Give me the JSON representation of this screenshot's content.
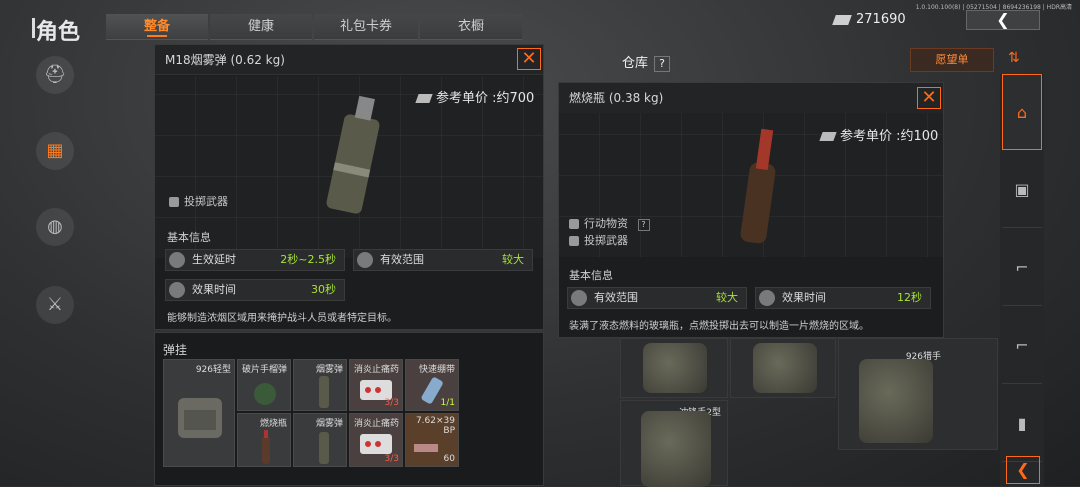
{
  "header": {
    "title": "角色",
    "tabs": [
      "整备",
      "健康",
      "礼包卡券",
      "衣橱"
    ],
    "money": "271690",
    "version": "1.0.100.100(8) | 05271504 | 86942361​98 | HDR高清"
  },
  "item1": {
    "name": "M18烟雾弹 (0.62 kg)",
    "price": "参考单价 :约700",
    "category": "投掷武器",
    "section": "基本信息",
    "stats": [
      {
        "label": "生效延时",
        "value": "2秒~2.5秒"
      },
      {
        "label": "有效范围",
        "value": "较大"
      },
      {
        "label": "效果时间",
        "value": "30秒"
      }
    ],
    "description": "能够制造浓烟区域用来掩护战斗人员或者特定目标。"
  },
  "item2": {
    "name": "燃烧瓶 (0.38 kg)",
    "price": "参考单价 :约100",
    "category1": "行动物资",
    "category2": "投掷武器",
    "section": "基本信息",
    "stats": [
      {
        "label": "有效范围",
        "value": "较大"
      },
      {
        "label": "效果时间",
        "value": "12秒"
      }
    ],
    "description": "装满了液态燃料的玻璃瓶，点燃投掷出去可以制造一片燃烧的区域。"
  },
  "loadout": {
    "title": "弹挂",
    "vest": "926轻型",
    "slots": [
      {
        "name": "破片手榴弹",
        "count": ""
      },
      {
        "name": "烟雾弹",
        "count": ""
      },
      {
        "name": "消炎止痛药",
        "count": "3/3"
      },
      {
        "name": "快速绷带",
        "count": "1/1"
      },
      {
        "name": "燃烧瓶",
        "count": ""
      },
      {
        "name": "烟雾弹",
        "count": ""
      },
      {
        "name": "消炎止痛药",
        "count": "3/3"
      },
      {
        "name": "7.62×39 BP",
        "count": "60"
      }
    ]
  },
  "warehouse": {
    "title": "仓库",
    "help": "?",
    "wishlist": "愿望单",
    "items": [
      "926猎手",
      "冲锋手2型"
    ]
  }
}
